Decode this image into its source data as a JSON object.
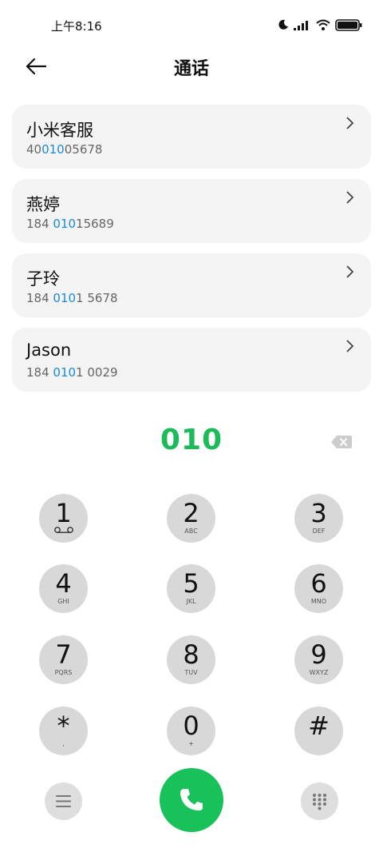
{
  "status_bar": {
    "time": "上午8:16",
    "icons": [
      "moon-icon",
      "signal-icon",
      "wifi-icon",
      "battery-icon"
    ]
  },
  "header": {
    "title": "通话",
    "back_icon": "arrow-left-icon"
  },
  "contacts": [
    {
      "name": "小米客服",
      "number_pre": "40",
      "number_hl": "010",
      "number_post": "05678"
    },
    {
      "name": "燕婷",
      "number_pre": "184 ",
      "number_hl": "010",
      "number_post": "15689"
    },
    {
      "name": "子玲",
      "number_pre": "184 ",
      "number_hl": "010",
      "number_post": "1 5678"
    },
    {
      "name": "Jason",
      "number_pre": "184 ",
      "number_hl": "010",
      "number_post": "1 0029"
    }
  ],
  "dialer": {
    "input": "010",
    "keys": [
      {
        "digit": "1",
        "letters": ""
      },
      {
        "digit": "2",
        "letters": "ABC"
      },
      {
        "digit": "3",
        "letters": "DEF"
      },
      {
        "digit": "4",
        "letters": "GHI"
      },
      {
        "digit": "5",
        "letters": "JKL"
      },
      {
        "digit": "6",
        "letters": "MNO"
      },
      {
        "digit": "7",
        "letters": "PQRS"
      },
      {
        "digit": "8",
        "letters": "TUV"
      },
      {
        "digit": "9",
        "letters": "WXYZ"
      },
      {
        "digit": "*",
        "letters": ","
      },
      {
        "digit": "0",
        "letters": "+"
      },
      {
        "digit": "#",
        "letters": ""
      }
    ]
  },
  "colors": {
    "accent_green": "#1dba5a",
    "call_green": "#18c15a",
    "highlight_blue": "#1a8ad8",
    "card_bg": "#f4f4f4",
    "key_bg": "#d8d8d8"
  }
}
